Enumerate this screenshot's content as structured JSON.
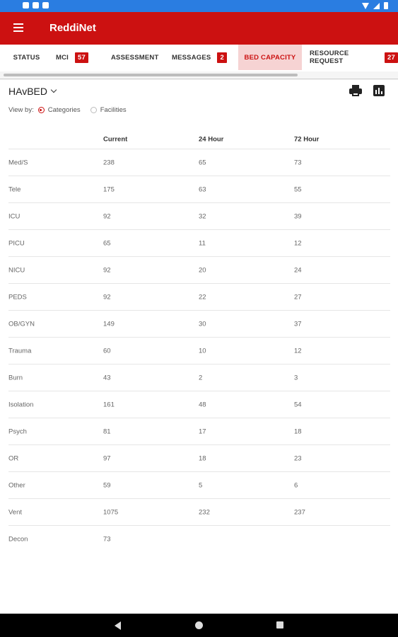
{
  "app": {
    "title": "ReddiNet"
  },
  "tabs": [
    {
      "label": "STATUS"
    },
    {
      "label": "MCI",
      "badge": "57"
    },
    {
      "label": "ASSESSMENT"
    },
    {
      "label": "MESSAGES",
      "badge": "2"
    },
    {
      "label": "BED CAPACITY",
      "active": true
    },
    {
      "label": "RESOURCE REQUEST",
      "badge": "27"
    }
  ],
  "toolbar": {
    "title": "HAvBED",
    "icons": [
      "print-icon",
      "bar-chart-icon"
    ]
  },
  "view_by": {
    "label": "View by:",
    "options": [
      "Categories",
      "Facilities"
    ],
    "selected": "Categories"
  },
  "table": {
    "headers": [
      "",
      "Current",
      "24 Hour",
      "72 Hour"
    ],
    "rows": [
      [
        "Med/S",
        "238",
        "65",
        "73"
      ],
      [
        "Tele",
        "175",
        "63",
        "55"
      ],
      [
        "ICU",
        "92",
        "32",
        "39"
      ],
      [
        "PICU",
        "65",
        "11",
        "12"
      ],
      [
        "NICU",
        "92",
        "20",
        "24"
      ],
      [
        "PEDS",
        "92",
        "22",
        "27"
      ],
      [
        "OB/GYN",
        "149",
        "30",
        "37"
      ],
      [
        "Trauma",
        "60",
        "10",
        "12"
      ],
      [
        "Burn",
        "43",
        "2",
        "3"
      ],
      [
        "Isolation",
        "161",
        "48",
        "54"
      ],
      [
        "Psych",
        "81",
        "17",
        "18"
      ],
      [
        "OR",
        "97",
        "18",
        "23"
      ],
      [
        "Other",
        "59",
        "5",
        "6"
      ],
      [
        "Vent",
        "1075",
        "232",
        "237"
      ],
      [
        "Decon",
        "73",
        "",
        ""
      ]
    ]
  },
  "colors": {
    "accent": "#cc1111",
    "status_bar": "#2a7de1",
    "active_tab_bg": "#f6d3d3"
  }
}
